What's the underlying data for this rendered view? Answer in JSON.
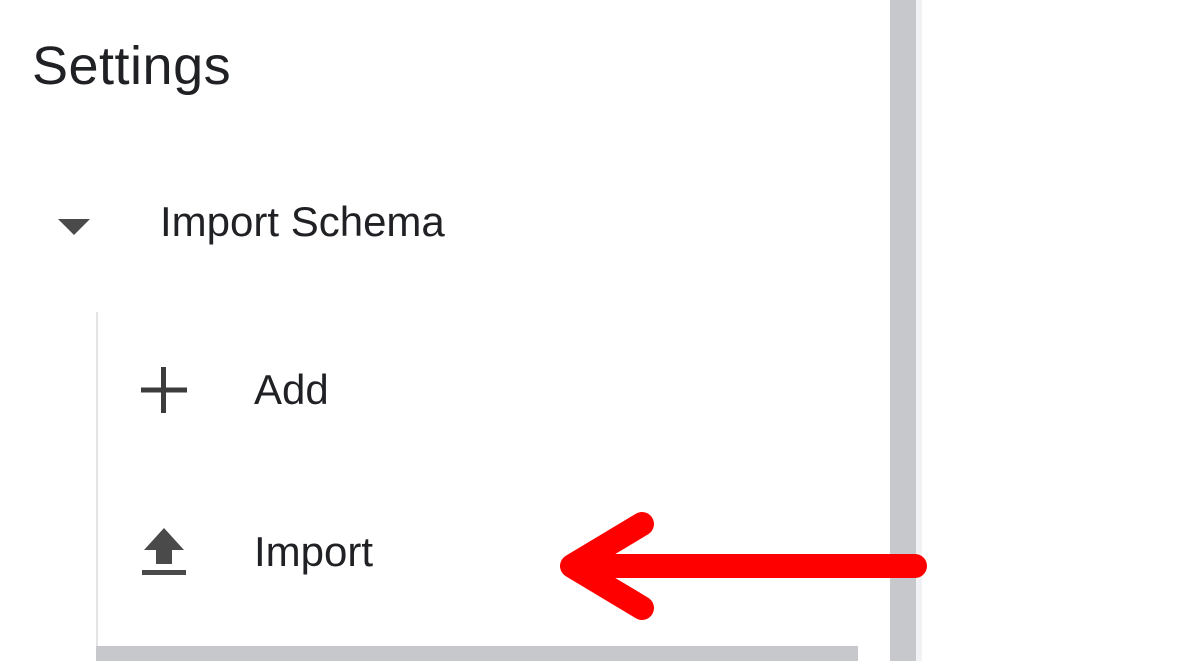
{
  "header": {
    "title": "Settings"
  },
  "group": {
    "label": "Import Schema",
    "icon": "caret-down-icon",
    "expanded": true
  },
  "items": [
    {
      "label": "Add",
      "icon": "plus-icon"
    },
    {
      "label": "Import",
      "icon": "upload-icon"
    }
  ],
  "annotation": {
    "type": "arrow",
    "color": "#ff0000",
    "points_to": "Import"
  },
  "colors": {
    "text": "#202124",
    "icon": "#4a4a4a",
    "scrollbar": "#c6c8cb",
    "annotation": "#ff0000"
  }
}
